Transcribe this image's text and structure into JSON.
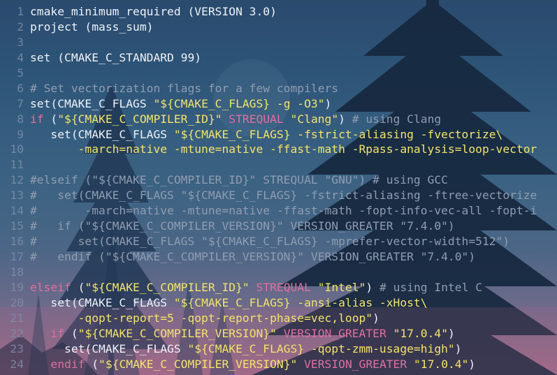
{
  "colors": {
    "string": "#f3e46a",
    "keyword": "#e06fa0",
    "comment": "#8f9cb1",
    "plain": "#eef2f7",
    "line_number": "#7d8ea8"
  },
  "editor": {
    "lines": [
      {
        "n": "1",
        "tokens": [
          {
            "t": "pl",
            "v": "cmake_minimum_required (VERSION 3.0)"
          }
        ]
      },
      {
        "n": "2",
        "tokens": [
          {
            "t": "pl",
            "v": "project (mass_sum)"
          }
        ]
      },
      {
        "n": "3",
        "tokens": []
      },
      {
        "n": "4",
        "tokens": [
          {
            "t": "pl",
            "v": "set (CMAKE_C_STANDARD 99)"
          }
        ]
      },
      {
        "n": "5",
        "tokens": []
      },
      {
        "n": "6",
        "tokens": [
          {
            "t": "cm",
            "v": "# Set vectorization flags for a few compilers"
          }
        ]
      },
      {
        "n": "7",
        "tokens": [
          {
            "t": "pl",
            "v": "set(CMAKE_C_FLAGS "
          },
          {
            "t": "str",
            "v": "\"${CMAKE_C_FLAGS} -g -O3\""
          },
          {
            "t": "pl",
            "v": ")"
          }
        ]
      },
      {
        "n": "8",
        "tokens": [
          {
            "t": "kw",
            "v": "if"
          },
          {
            "t": "pl",
            "v": " ("
          },
          {
            "t": "str",
            "v": "\"${CMAKE_C_COMPILER_ID}\""
          },
          {
            "t": "pl",
            "v": " "
          },
          {
            "t": "kw",
            "v": "STREQUAL"
          },
          {
            "t": "pl",
            "v": " "
          },
          {
            "t": "str",
            "v": "\"Clang\""
          },
          {
            "t": "pl",
            "v": ") "
          },
          {
            "t": "cm",
            "v": "# using Clang"
          }
        ]
      },
      {
        "n": "9",
        "tokens": [
          {
            "t": "pl",
            "v": "   set(CMAKE_C_FLAGS "
          },
          {
            "t": "str",
            "v": "\"${CMAKE_C_FLAGS} -fstrict-aliasing -fvectorize\\"
          }
        ]
      },
      {
        "n": "10",
        "tokens": [
          {
            "t": "str",
            "v": "       -march=native -mtune=native -ffast-math -Rpass-analysis=loop-vector"
          }
        ]
      },
      {
        "n": "11",
        "tokens": []
      },
      {
        "n": "12",
        "tokens": [
          {
            "t": "cm",
            "v": "#elseif (\"${CMAKE_C_COMPILER_ID}\" STREQUAL \"GNU\") # using GCC"
          }
        ]
      },
      {
        "n": "13",
        "tokens": [
          {
            "t": "cm",
            "v": "#   set(CMAKE_C_FLAGS \"${CMAKE_C_FLAGS} -fstrict-aliasing -ftree-vectorize"
          }
        ]
      },
      {
        "n": "14",
        "tokens": [
          {
            "t": "cm",
            "v": "#       -march=native -mtune=native -ffast-math -fopt-info-vec-all -fopt-i"
          }
        ]
      },
      {
        "n": "15",
        "tokens": [
          {
            "t": "cm",
            "v": "#   if (\"${CMAKE_C_COMPILER_VERSION}\" VERSION_GREATER \"7.4.0\")"
          }
        ]
      },
      {
        "n": "16",
        "tokens": [
          {
            "t": "cm",
            "v": "#      set(CMAKE_C_FLAGS \"${CMAKE_C_FLAGS} -mprefer-vector-width=512\")"
          }
        ]
      },
      {
        "n": "17",
        "tokens": [
          {
            "t": "cm",
            "v": "#   endif (\"${CMAKE_C_COMPILER_VERSION}\" VERSION_GREATER \"7.4.0\")"
          }
        ]
      },
      {
        "n": "18",
        "tokens": []
      },
      {
        "n": "19",
        "tokens": [
          {
            "t": "kw",
            "v": "elseif"
          },
          {
            "t": "pl",
            "v": " ("
          },
          {
            "t": "str",
            "v": "\"${CMAKE_C_COMPILER_ID}\""
          },
          {
            "t": "pl",
            "v": " "
          },
          {
            "t": "kw",
            "v": "STREQUAL"
          },
          {
            "t": "pl",
            "v": " "
          },
          {
            "t": "str",
            "v": "\"Intel\""
          },
          {
            "t": "pl",
            "v": ") "
          },
          {
            "t": "cm",
            "v": "# using Intel C"
          }
        ]
      },
      {
        "n": "20",
        "tokens": [
          {
            "t": "pl",
            "v": "   set(CMAKE_C_FLAGS "
          },
          {
            "t": "str",
            "v": "\"${CMAKE_C_FLAGS} -ansi-alias -xHost\\"
          }
        ]
      },
      {
        "n": "21",
        "tokens": [
          {
            "t": "str",
            "v": "       -qopt-report=5 -qopt-report-phase=vec,loop\""
          },
          {
            "t": "pl",
            "v": ")"
          }
        ]
      },
      {
        "n": "22",
        "tokens": [
          {
            "t": "pl",
            "v": "   "
          },
          {
            "t": "kw",
            "v": "if"
          },
          {
            "t": "pl",
            "v": " ("
          },
          {
            "t": "str",
            "v": "\"${CMAKE_C_COMPILER_VERSION}\""
          },
          {
            "t": "pl",
            "v": " "
          },
          {
            "t": "kw",
            "v": "VERSION_GREATER"
          },
          {
            "t": "pl",
            "v": " "
          },
          {
            "t": "str",
            "v": "\"17.0.4\""
          },
          {
            "t": "pl",
            "v": ")"
          }
        ]
      },
      {
        "n": "23",
        "tokens": [
          {
            "t": "pl",
            "v": "     set(CMAKE_C_FLAGS "
          },
          {
            "t": "str",
            "v": "\"${CMAKE_C_FLAGS} -qopt-zmm-usage=high\""
          },
          {
            "t": "pl",
            "v": ")"
          }
        ]
      },
      {
        "n": "24",
        "tokens": [
          {
            "t": "pl",
            "v": "   "
          },
          {
            "t": "kw",
            "v": "endif"
          },
          {
            "t": "pl",
            "v": " ("
          },
          {
            "t": "str",
            "v": "\"${CMAKE_C_COMPILER_VERSION}\""
          },
          {
            "t": "pl",
            "v": " "
          },
          {
            "t": "kw",
            "v": "VERSION_GREATER"
          },
          {
            "t": "pl",
            "v": " "
          },
          {
            "t": "str",
            "v": "\"17.0.4\""
          },
          {
            "t": "pl",
            "v": ")"
          }
        ]
      }
    ]
  }
}
